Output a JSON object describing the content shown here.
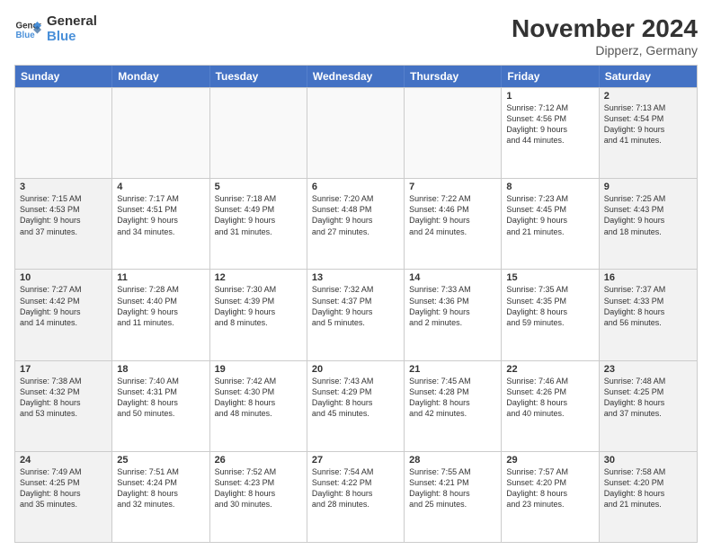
{
  "logo": {
    "line1": "General",
    "line2": "Blue"
  },
  "title": "November 2024",
  "location": "Dipperz, Germany",
  "header": {
    "days": [
      "Sunday",
      "Monday",
      "Tuesday",
      "Wednesday",
      "Thursday",
      "Friday",
      "Saturday"
    ]
  },
  "weeks": [
    [
      {
        "day": "",
        "info": ""
      },
      {
        "day": "",
        "info": ""
      },
      {
        "day": "",
        "info": ""
      },
      {
        "day": "",
        "info": ""
      },
      {
        "day": "",
        "info": ""
      },
      {
        "day": "1",
        "info": "Sunrise: 7:12 AM\nSunset: 4:56 PM\nDaylight: 9 hours\nand 44 minutes."
      },
      {
        "day": "2",
        "info": "Sunrise: 7:13 AM\nSunset: 4:54 PM\nDaylight: 9 hours\nand 41 minutes."
      }
    ],
    [
      {
        "day": "3",
        "info": "Sunrise: 7:15 AM\nSunset: 4:53 PM\nDaylight: 9 hours\nand 37 minutes."
      },
      {
        "day": "4",
        "info": "Sunrise: 7:17 AM\nSunset: 4:51 PM\nDaylight: 9 hours\nand 34 minutes."
      },
      {
        "day": "5",
        "info": "Sunrise: 7:18 AM\nSunset: 4:49 PM\nDaylight: 9 hours\nand 31 minutes."
      },
      {
        "day": "6",
        "info": "Sunrise: 7:20 AM\nSunset: 4:48 PM\nDaylight: 9 hours\nand 27 minutes."
      },
      {
        "day": "7",
        "info": "Sunrise: 7:22 AM\nSunset: 4:46 PM\nDaylight: 9 hours\nand 24 minutes."
      },
      {
        "day": "8",
        "info": "Sunrise: 7:23 AM\nSunset: 4:45 PM\nDaylight: 9 hours\nand 21 minutes."
      },
      {
        "day": "9",
        "info": "Sunrise: 7:25 AM\nSunset: 4:43 PM\nDaylight: 9 hours\nand 18 minutes."
      }
    ],
    [
      {
        "day": "10",
        "info": "Sunrise: 7:27 AM\nSunset: 4:42 PM\nDaylight: 9 hours\nand 14 minutes."
      },
      {
        "day": "11",
        "info": "Sunrise: 7:28 AM\nSunset: 4:40 PM\nDaylight: 9 hours\nand 11 minutes."
      },
      {
        "day": "12",
        "info": "Sunrise: 7:30 AM\nSunset: 4:39 PM\nDaylight: 9 hours\nand 8 minutes."
      },
      {
        "day": "13",
        "info": "Sunrise: 7:32 AM\nSunset: 4:37 PM\nDaylight: 9 hours\nand 5 minutes."
      },
      {
        "day": "14",
        "info": "Sunrise: 7:33 AM\nSunset: 4:36 PM\nDaylight: 9 hours\nand 2 minutes."
      },
      {
        "day": "15",
        "info": "Sunrise: 7:35 AM\nSunset: 4:35 PM\nDaylight: 8 hours\nand 59 minutes."
      },
      {
        "day": "16",
        "info": "Sunrise: 7:37 AM\nSunset: 4:33 PM\nDaylight: 8 hours\nand 56 minutes."
      }
    ],
    [
      {
        "day": "17",
        "info": "Sunrise: 7:38 AM\nSunset: 4:32 PM\nDaylight: 8 hours\nand 53 minutes."
      },
      {
        "day": "18",
        "info": "Sunrise: 7:40 AM\nSunset: 4:31 PM\nDaylight: 8 hours\nand 50 minutes."
      },
      {
        "day": "19",
        "info": "Sunrise: 7:42 AM\nSunset: 4:30 PM\nDaylight: 8 hours\nand 48 minutes."
      },
      {
        "day": "20",
        "info": "Sunrise: 7:43 AM\nSunset: 4:29 PM\nDaylight: 8 hours\nand 45 minutes."
      },
      {
        "day": "21",
        "info": "Sunrise: 7:45 AM\nSunset: 4:28 PM\nDaylight: 8 hours\nand 42 minutes."
      },
      {
        "day": "22",
        "info": "Sunrise: 7:46 AM\nSunset: 4:26 PM\nDaylight: 8 hours\nand 40 minutes."
      },
      {
        "day": "23",
        "info": "Sunrise: 7:48 AM\nSunset: 4:25 PM\nDaylight: 8 hours\nand 37 minutes."
      }
    ],
    [
      {
        "day": "24",
        "info": "Sunrise: 7:49 AM\nSunset: 4:25 PM\nDaylight: 8 hours\nand 35 minutes."
      },
      {
        "day": "25",
        "info": "Sunrise: 7:51 AM\nSunset: 4:24 PM\nDaylight: 8 hours\nand 32 minutes."
      },
      {
        "day": "26",
        "info": "Sunrise: 7:52 AM\nSunset: 4:23 PM\nDaylight: 8 hours\nand 30 minutes."
      },
      {
        "day": "27",
        "info": "Sunrise: 7:54 AM\nSunset: 4:22 PM\nDaylight: 8 hours\nand 28 minutes."
      },
      {
        "day": "28",
        "info": "Sunrise: 7:55 AM\nSunset: 4:21 PM\nDaylight: 8 hours\nand 25 minutes."
      },
      {
        "day": "29",
        "info": "Sunrise: 7:57 AM\nSunset: 4:20 PM\nDaylight: 8 hours\nand 23 minutes."
      },
      {
        "day": "30",
        "info": "Sunrise: 7:58 AM\nSunset: 4:20 PM\nDaylight: 8 hours\nand 21 minutes."
      }
    ]
  ]
}
